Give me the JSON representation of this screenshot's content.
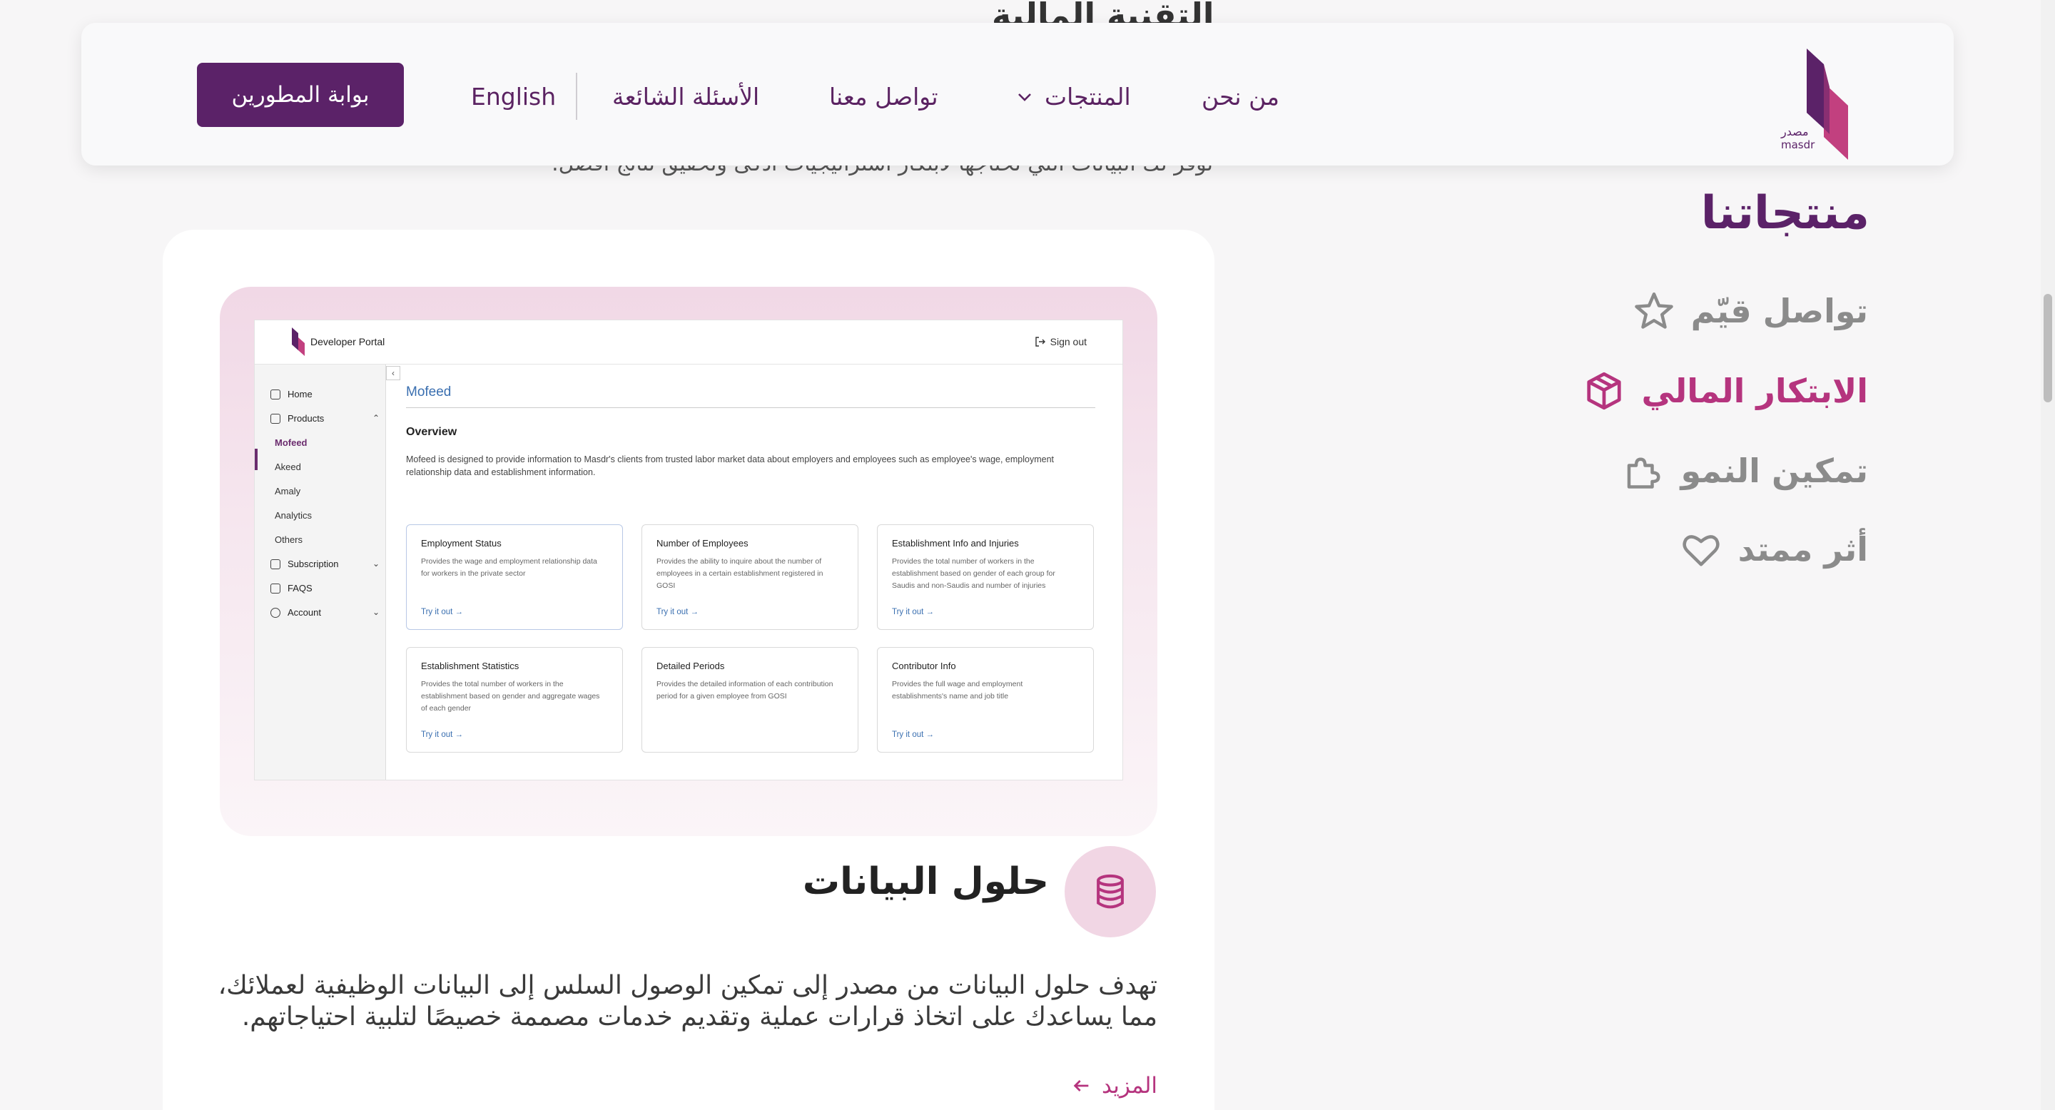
{
  "background": {
    "heading_fragment": "التقنية المالية",
    "subtext_fragment": "توفر لك البيانات التي تحتاجها لابتكار استراتيجيات أذكى وتحقيق نتائج أفضل."
  },
  "header": {
    "nav": {
      "about": "من نحن",
      "products": "المنتجات",
      "contact": "تواصل معنا",
      "faq": "الأسئلة الشائعة",
      "language": "English"
    },
    "dev_portal_button": "بوابة المطورين"
  },
  "sidebar": {
    "title": "منتجاتنا",
    "items": [
      {
        "label": "تواصل قيّم",
        "icon": "star-icon",
        "active": false
      },
      {
        "label": "الابتكار المالي",
        "icon": "cube-icon",
        "active": true
      },
      {
        "label": "تمكين النمو",
        "icon": "puzzle-icon",
        "active": false
      },
      {
        "label": "أثر ممتد",
        "icon": "heart-icon",
        "active": false
      }
    ]
  },
  "portal": {
    "title": "Developer Portal",
    "sign_out": "Sign out",
    "nav": {
      "home": "Home",
      "products": "Products",
      "sub": [
        "Mofeed",
        "Akeed",
        "Amaly",
        "Analytics",
        "Others"
      ],
      "subscription": "Subscription",
      "faqs": "FAQS",
      "account": "Account"
    },
    "page_title": "Mofeed",
    "overview": "Overview",
    "description": "Mofeed is designed to provide information to Masdr's clients from trusted labor market data about employers and employees such as employee's wage, employment relationship data and establishment information.",
    "tiles": [
      {
        "title": "Employment Status",
        "desc": "Provides the wage and employment relationship data for workers in the private sector",
        "cta": "Try it out →"
      },
      {
        "title": "Number of Employees",
        "desc": "Provides the ability to inquire about the number of employees in a certain establishment registered in GOSI",
        "cta": "Try it out →"
      },
      {
        "title": "Establishment Info and Injuries",
        "desc": "Provides the total number of workers in the establishment based on gender of each group for Saudis and non-Saudis and number of injuries",
        "cta": "Try it out →"
      },
      {
        "title": "Establishment Statistics",
        "desc": "Provides the total number of workers in the establishment based on gender and aggregate wages of each gender",
        "cta": "Try it out →"
      },
      {
        "title": "Detailed Periods",
        "desc": "Provides the detailed information of each contribution period for a given employee from GOSI",
        "cta": ""
      },
      {
        "title": "Contributor Info",
        "desc": "Provides the full wage and employment establishments's name and job title",
        "cta": "Try it out →"
      }
    ]
  },
  "data_solutions": {
    "icon": "database-icon",
    "title": "حلول البيانات",
    "description": "تهدف حلول البيانات من مصدر إلى تمكين الوصول السلس إلى البيانات الوظيفية لعملائك، مما يساعدك على اتخاذ قرارات عملية وتقديم خدمات مصممة خصيصًا لتلبية احتياجاتهم.",
    "more_link": "المزيد"
  },
  "colors": {
    "brand": "#5b2268",
    "accent": "#b5347e",
    "muted": "#8b8b8b"
  }
}
